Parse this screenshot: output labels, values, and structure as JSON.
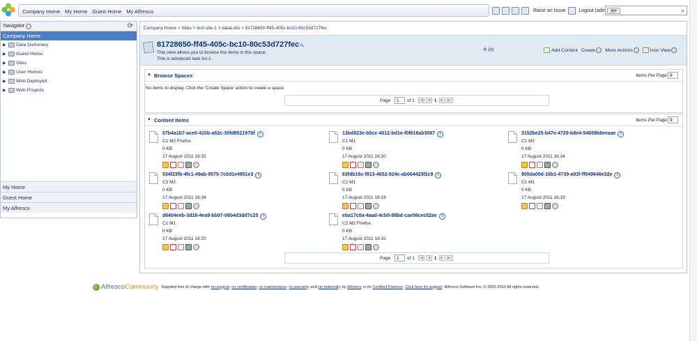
{
  "topnav": {
    "links": [
      "Company Home",
      "My Home",
      "Guest Home",
      "My Alfresco"
    ]
  },
  "tools": {
    "raise_issue": "Raise an Issue",
    "logout": "Logout (admin)"
  },
  "search": {
    "placeholder": ""
  },
  "navigator": {
    "label": "Navigator",
    "selected": "Company Home",
    "tree": [
      "Data Dictionary",
      "Guest Home",
      "Sites",
      "User Homes",
      "Web Deployed",
      "Web Projects"
    ],
    "bottom": [
      "My Home",
      "Guest Home",
      "My Alfresco"
    ]
  },
  "breadcrumb": "Company Home > Sites > test-site-1 > dataLists > 81728650-ff45-405c-bc10-80c53d727fec",
  "header": {
    "title": "81728650-ff45-405c-bc10-80c53d727fec",
    "line1": "This view allows you to browse the items in this space.",
    "line2": "This is advanced task list 1.",
    "rss": "(0)",
    "add_content": "Add Content",
    "create": "Create",
    "more_actions": "More Actions",
    "view": "Icon View"
  },
  "browse_spaces": {
    "title": "Browse Spaces",
    "items_per_page_label": "Items Per Page",
    "items_per_page": "9",
    "empty": "No items to display. Click the 'Create Space' action to create a space."
  },
  "content_items": {
    "title": "Content Items",
    "items_per_page_label": "Items Per Page",
    "items_per_page": "9",
    "items": [
      {
        "name": "07b4a1b7-ace0-410b-a62c-30fd852197bf",
        "desc": "C1 M2 Firefox",
        "size": "0 KB",
        "date": "17 August 2011 16:32"
      },
      {
        "name": "13bd823e-b5ce-4012-bd1e-f0f616ab3087",
        "desc": "C1 M1",
        "size": "0 KB",
        "date": "17 August 2011 16:20"
      },
      {
        "name": "3152be25-b47e-4729-b8e4-54659b8eeaae",
        "desc": "C1 M2",
        "size": "0 KB",
        "date": "17 August 2011 16:34"
      },
      {
        "name": "534f23fb-4fc1-49ab-9575-7c0d1e4951e3",
        "desc": "C2 M2",
        "size": "0 KB",
        "date": "17 August 2011 16:34"
      },
      {
        "name": "63fdb16c-f813-4652-924c-ab064423f2c9",
        "desc": "C2 M1",
        "size": "0 KB",
        "date": "17 August 2011 16:19"
      },
      {
        "name": "905da00d-16b1-4739-a93f-ff049646e32e",
        "desc": "C1 M1",
        "size": "0 KB",
        "date": "17 August 2011 16:19"
      },
      {
        "name": "d6404eeb-3d18-4ea9-bb97-06b4d3dd7c25",
        "desc": "C1 M1",
        "size": "0 KB",
        "date": "17 August 2011 16:20"
      },
      {
        "name": "eba17c0a-4aad-4cb0-88bd-cae56cec02ae",
        "desc": "C2 M2 Firefox",
        "size": "0 KB",
        "date": "17 August 2011 16:32"
      }
    ]
  },
  "pager": {
    "page_label": "Page",
    "page_value": "1",
    "of_label": "of 1",
    "current": "1"
  },
  "footer": {
    "brand_a": "Alfresco",
    "brand_b": "Community",
    "t1": "Supplied free of charge with",
    "l1": "no support",
    "l2": "no certification",
    "l3": "no maintenance",
    "l4": "no warranty",
    "t2": "and",
    "l5": "no indemnity",
    "t3": "by",
    "l6": "Alfresco",
    "t4": "or its",
    "l7": "Certified Partners",
    "l8": "Click here for support",
    "t5": "Alfresco Software Inc. © 2005-2010 All rights reserved."
  }
}
